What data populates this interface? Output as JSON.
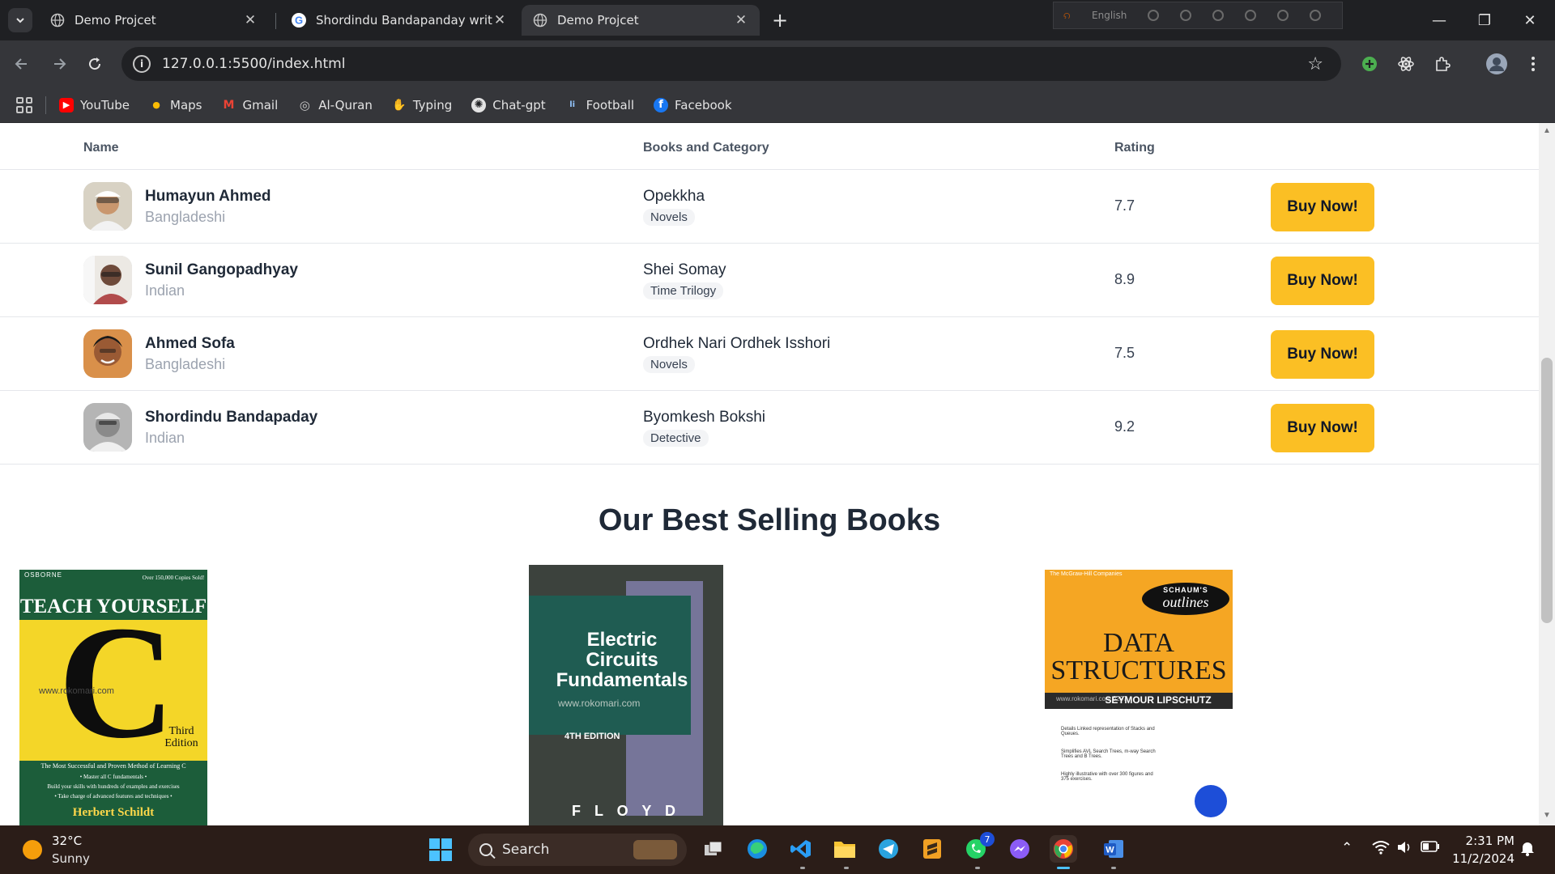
{
  "browser": {
    "tabs": [
      {
        "title": "Demo Projcet",
        "active": false
      },
      {
        "title": "Shordindu Bandapanday writr -",
        "active": false
      },
      {
        "title": "Demo Projcet",
        "active": true
      }
    ],
    "new_tab_glyph": "+",
    "ext_strip_lang": "English",
    "window_controls": [
      "—",
      "❐",
      "✕"
    ],
    "url": "127.0.0.1:5500/index.html",
    "bookmarks": [
      {
        "label": "YouTube",
        "color": "#ff0000",
        "glyph": "▶"
      },
      {
        "label": "Maps",
        "color": "#34a853",
        "glyph": "●"
      },
      {
        "label": "Gmail",
        "color": "#ea4335",
        "glyph": "M"
      },
      {
        "label": "Al-Quran",
        "color": "#5f6368",
        "glyph": "◎"
      },
      {
        "label": "Typing",
        "color": "#f97316",
        "glyph": "✋"
      },
      {
        "label": "Chat-gpt",
        "color": "#202124",
        "glyph": "✺"
      },
      {
        "label": "Football",
        "color": "#1e3a8a",
        "glyph": "li"
      },
      {
        "label": "Facebook",
        "color": "#1877f2",
        "glyph": "f"
      }
    ]
  },
  "table": {
    "headers": {
      "name": "Name",
      "books": "Books and Category",
      "rating": "Rating"
    },
    "rows": [
      {
        "author": "Humayun Ahmed",
        "nation": "Bangladeshi",
        "book": "Opekkha",
        "category": "Novels",
        "rating": "7.7",
        "button": "Buy Now!"
      },
      {
        "author": "Sunil Gangopadhyay",
        "nation": "Indian",
        "book": "Shei Somay",
        "category": "Time Trilogy",
        "rating": "8.9",
        "button": "Buy Now!"
      },
      {
        "author": "Ahmed Sofa",
        "nation": "Bangladeshi",
        "book": "Ordhek Nari Ordhek Isshori",
        "category": "Novels",
        "rating": "7.5",
        "button": "Buy Now!"
      },
      {
        "author": "Shordindu Bandapaday",
        "nation": "Indian",
        "book": "Byomkesh Bokshi",
        "category": "Detective",
        "rating": "9.2",
        "button": "Buy Now!"
      }
    ]
  },
  "best_selling": {
    "title": "Our Best Selling Books",
    "covers": [
      {
        "publisher": "OSBORNE",
        "tag": "Over 150,000 Copies Sold!",
        "title_top": "TEACH YOURSELF",
        "letter": "C",
        "edition": "Third Edition",
        "watermark": "www.rokomari.com",
        "tagline": "The Most Successful and Proven Method of Learning C",
        "bullet1": "• Master all C fundamentals •",
        "bullet2": "Build your skills with hundreds of examples and exercises",
        "bullet3": "• Take charge of advanced features and techniques •",
        "author": "Herbert Schildt"
      },
      {
        "title": "Electric Circuits Fundamentals",
        "watermark": "www.rokomari.com",
        "edition": "4TH EDITION",
        "author": "F L O Y D"
      },
      {
        "publisher": "The McGraw-Hill Companies",
        "series": "SCHAUM'S",
        "series2": "outlines",
        "title1": "DATA",
        "title2": "STRUCTURES",
        "author": "SEYMOUR LIPSCHUTZ",
        "watermark": "www.rokomari.com 6297",
        "point1": "Details Linked representation of Stacks and Queues.",
        "point2": "Simplifies AVL Search Trees, m-way Search Trees and B Trees.",
        "point3": "Highly illustrative with over 300 figures and 375 exercises."
      }
    ]
  },
  "taskbar": {
    "temp": "32°C",
    "condition": "Sunny",
    "search": "Search",
    "whatsapp_badge": "7",
    "time": "2:31 PM",
    "date": "11/2/2024"
  }
}
